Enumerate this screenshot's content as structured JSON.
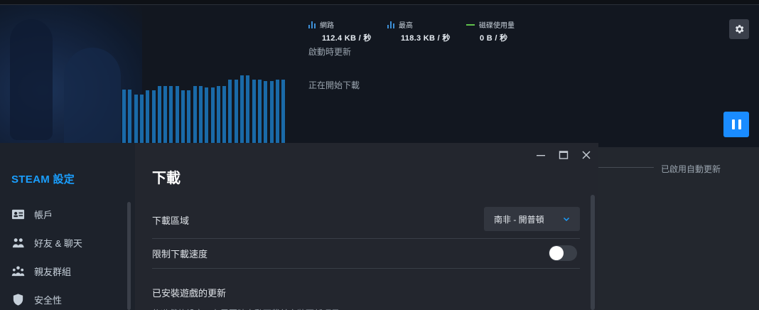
{
  "stats": {
    "network": {
      "label": "網路",
      "value": "112.4 KB / 秒"
    },
    "peak": {
      "label": "最高",
      "value": "118.3 KB / 秒"
    },
    "disk": {
      "label": "磁碟使用量",
      "value": "0 B / 秒"
    }
  },
  "download": {
    "status_update_on_launch": "啟動時更新",
    "status_starting": "正在開始下載",
    "auto_update_enabled": "已啟用自動更新"
  },
  "graph": {
    "series_color": "#1a6aa8",
    "bar_levels": [
      0.74,
      0.74,
      0.67,
      0.67,
      0.73,
      0.73,
      0.79,
      0.79,
      0.79,
      0.79,
      0.73,
      0.73,
      0.79,
      0.79,
      0.77,
      0.77,
      0.79,
      0.79,
      0.88,
      0.88,
      0.94,
      0.94,
      0.88,
      0.88,
      0.86,
      0.86,
      0.88,
      0.88
    ]
  },
  "settings": {
    "sidebar_title": "STEAM 設定",
    "sidebar_items": [
      {
        "label": "帳戶",
        "icon": "account-card-icon"
      },
      {
        "label": "好友 & 聊天",
        "icon": "friends-icon"
      },
      {
        "label": "親友群組",
        "icon": "family-group-icon"
      },
      {
        "label": "安全性",
        "icon": "shield-icon"
      }
    ],
    "panel_title": "下載",
    "download_region_label": "下載區域",
    "download_region_value": "南非 - 開普頓",
    "limit_speed_label": "限制下載速度",
    "limit_speed_enabled": false,
    "installed_updates_label": "已安裝遊戲的更新",
    "partial_line": "依遊戲的設定，在需要時自動下載並安裝更新項目"
  },
  "colors": {
    "accent": "#1a9fff",
    "pause_button": "#1a8cff",
    "disk_line": "#5fc14b"
  }
}
